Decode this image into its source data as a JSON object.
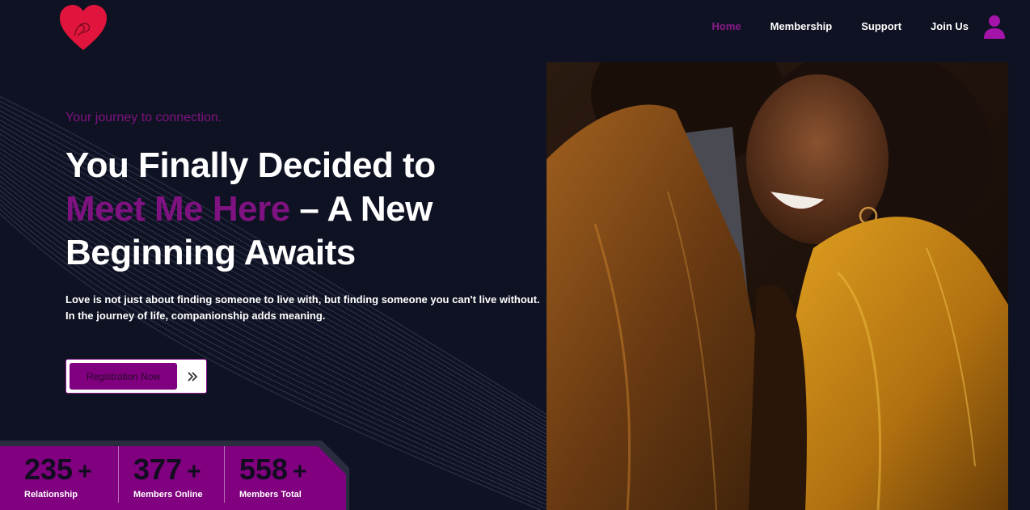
{
  "header": {
    "logo_icon": "heart-logo-icon",
    "nav": [
      {
        "label": "Home",
        "active": true
      },
      {
        "label": "Membership",
        "active": false
      },
      {
        "label": "Support",
        "active": false
      },
      {
        "label": "Join Us",
        "active": false
      }
    ],
    "user_icon": "user-icon"
  },
  "hero": {
    "tagline": "Your journey to connection.",
    "headline_line1": "You Finally Decided to",
    "headline_accent": "Meet Me Here",
    "headline_rest": " – A New Beginning Awaits",
    "description_line1": "Love is not just about finding someone to live with, but finding someone you can't live without.",
    "description_line2": "In the journey of life, companionship adds meaning.",
    "cta_label": "Registration Now",
    "cta_icon": "double-chevron-right-icon",
    "photo_icon": "couple-photo"
  },
  "stats": [
    {
      "value": "235",
      "plus": "+",
      "label": "Relationship"
    },
    {
      "value": "377",
      "plus": "+",
      "label": "Members Online"
    },
    {
      "value": "558",
      "plus": "+",
      "label": "Members Total"
    }
  ],
  "colors": {
    "background": "#0f1222",
    "accent": "#80007f",
    "heart": "#e0143c",
    "text": "#ffffff"
  }
}
